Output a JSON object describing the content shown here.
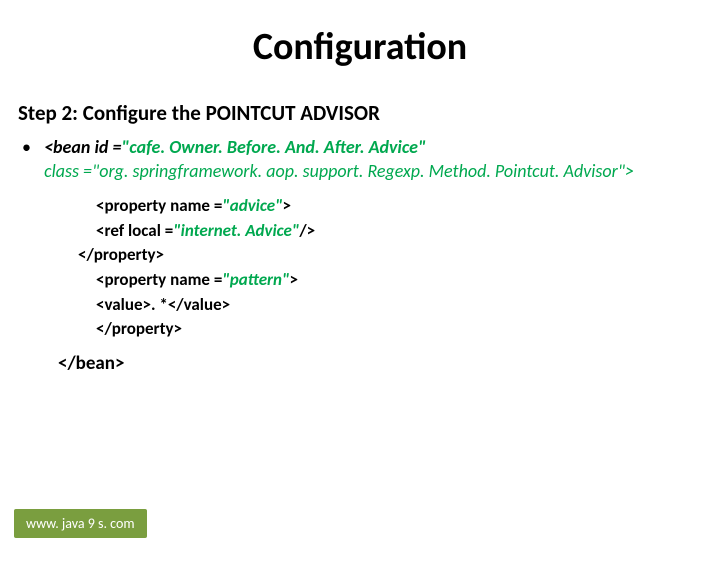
{
  "title": "Configuration",
  "step_heading": "Step 2: Configure the POINTCUT ADVISOR",
  "bullet": "•",
  "bean_open": {
    "prefix": "<bean id =",
    "id_value": "\"cafe. Owner. Before. And. After. Advice\""
  },
  "class_line": "class =\"org. springframework. aop. support. Regexp. Method. Pointcut. Advisor\">",
  "inner": {
    "prop1_open_prefix": "<property name =",
    "prop1_open_value": "\"advice\"",
    "prop1_open_suffix": ">",
    "ref_prefix": "<ref local =",
    "ref_value": "\"internet. Advice\"",
    "ref_suffix": "/>",
    "prop_close": "</property>",
    "prop2_open_prefix": "<property name =",
    "prop2_open_value": "\"pattern\"",
    "prop2_open_suffix": ">",
    "value_line": "<value>. *</value>",
    "prop2_close": "</property>"
  },
  "bean_close": "</bean>",
  "footer": "www. java 9 s. com"
}
